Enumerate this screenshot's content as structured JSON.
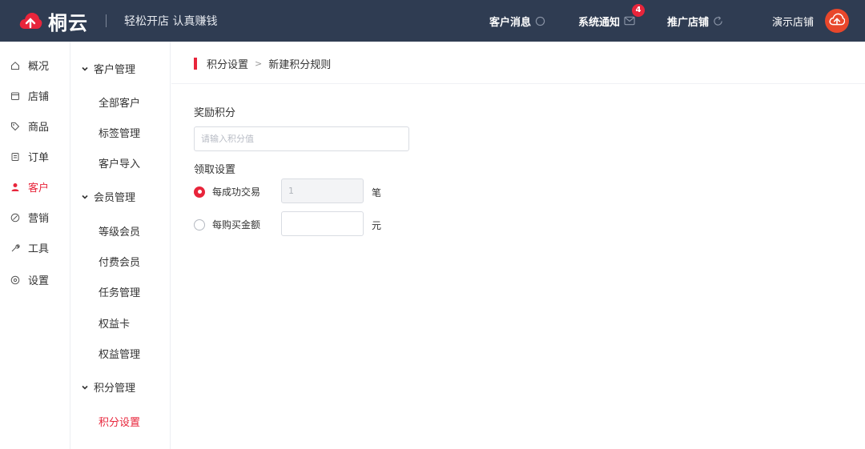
{
  "header": {
    "logo_text": "桐云",
    "slogan": "轻松开店 认真赚钱",
    "customer_messages": "客户消息",
    "system_notice": "系统通知",
    "system_notice_badge": "4",
    "promote_shop": "推广店铺",
    "shop_name": "演示店铺"
  },
  "sidebar": {
    "items": [
      {
        "label": "概况",
        "icon": "home-icon"
      },
      {
        "label": "店铺",
        "icon": "shop-icon"
      },
      {
        "label": "商品",
        "icon": "tag-icon"
      },
      {
        "label": "订单",
        "icon": "order-icon"
      },
      {
        "label": "客户",
        "icon": "user-icon"
      },
      {
        "label": "营销",
        "icon": "marketing-icon"
      },
      {
        "label": "工具",
        "icon": "tool-icon"
      },
      {
        "label": "设置",
        "icon": "settings-icon"
      }
    ],
    "active": "客户"
  },
  "subnav": {
    "group_customer": "客户管理",
    "all_customers": "全部客户",
    "tag_management": "标签管理",
    "customer_import": "客户导入",
    "group_member": "会员管理",
    "level_member": "等级会员",
    "paid_member": "付费会员",
    "task_management": "任务管理",
    "benefit_card": "权益卡",
    "benefit_management": "权益管理",
    "group_points": "积分管理",
    "points_settings": "积分设置"
  },
  "breadcrumb": {
    "parent": "积分设置",
    "separator": ">",
    "current": "新建积分规则"
  },
  "form": {
    "reward_points_label": "奖励积分",
    "reward_points_placeholder": "请输入积分值",
    "claim_settings_label": "领取设置",
    "option1_label": "每成功交易",
    "option1_value": "1",
    "option1_unit": "笔",
    "option2_label": "每购买金额",
    "option2_value": "",
    "option2_unit": "元",
    "selected_option": "option1"
  },
  "colors": {
    "topbar": "#2f3c52",
    "accent": "#e8253b"
  }
}
